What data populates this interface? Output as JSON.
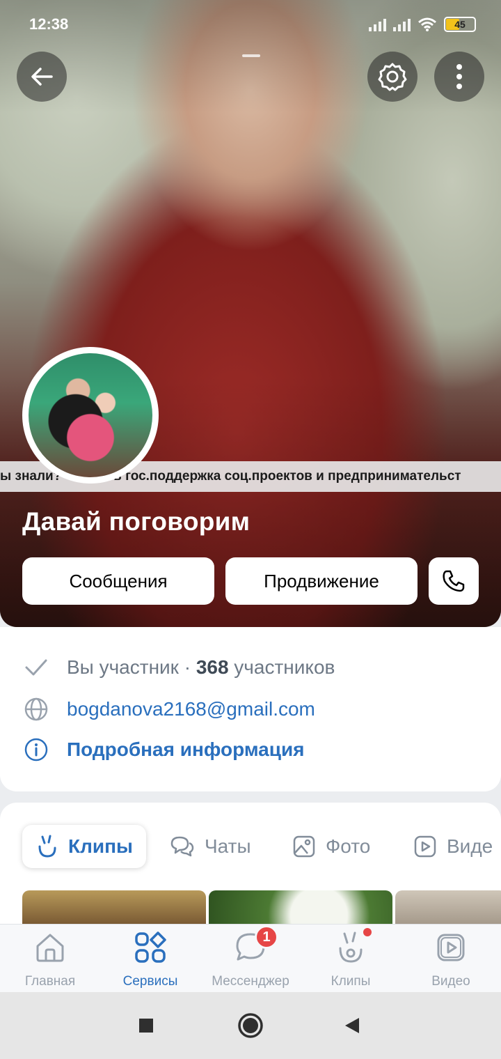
{
  "status_bar": {
    "time": "12:38",
    "battery_level": "45",
    "icons": [
      "signal-icon",
      "signal-icon",
      "wifi-icon",
      "battery-icon"
    ]
  },
  "header": {
    "back_icon": "arrow-left-icon",
    "settings_icon": "gear-icon",
    "more_icon": "more-vertical-icon"
  },
  "cover": {
    "ticker_text": "ы знали? Что есть гос.поддержка соц.проектов и предпринимательст"
  },
  "group": {
    "title": "Давай поговорим",
    "actions": {
      "messages_label": "Сообщения",
      "promotion_label": "Продвижение",
      "call_icon": "phone-icon"
    }
  },
  "info": {
    "membership": "Вы участник",
    "separator": " · ",
    "members_count": "368",
    "members_word": " участников",
    "email": "bogdanova2168@gmail.com",
    "details_link": "Подробная информация"
  },
  "tabs": [
    {
      "label": "Клипы",
      "icon": "clips-icon",
      "selected": true
    },
    {
      "label": "Чаты",
      "icon": "chats-icon",
      "selected": false
    },
    {
      "label": "Фото",
      "icon": "photo-icon",
      "selected": false
    },
    {
      "label": "Виде",
      "icon": "video-icon",
      "selected": false
    }
  ],
  "bottom_nav": [
    {
      "label": "Главная",
      "icon": "home-icon"
    },
    {
      "label": "Сервисы",
      "icon": "services-icon",
      "active": true
    },
    {
      "label": "Мессенджер",
      "icon": "messenger-icon",
      "badge": "1"
    },
    {
      "label": "Клипы",
      "icon": "clips-icon",
      "dot": true
    },
    {
      "label": "Видео",
      "icon": "video-icon"
    }
  ],
  "colors": {
    "accent": "#2a6fbd",
    "badge": "#e64646",
    "muted": "#818c99"
  }
}
